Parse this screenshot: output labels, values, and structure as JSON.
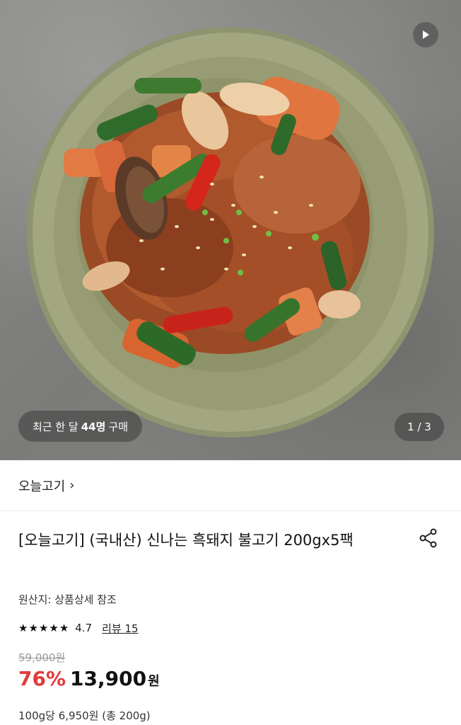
{
  "hero": {
    "recent_prefix": "최근 한 달",
    "recent_count": "44명",
    "recent_suffix": "구매",
    "counter": "1 / 3"
  },
  "brand": {
    "name": "오늘고기",
    "chevron": "›"
  },
  "product": {
    "title": "[오늘고기] (국내산) 신나는 흑돼지 불고기 200gx5팩",
    "origin": "원산지: 상품상세 참조",
    "rating": "4.7",
    "review_link": "리뷰 15",
    "original_price": "59,000원",
    "discount": "76%",
    "price": "13,900",
    "currency": "원",
    "unit_price": "100g당 6,950원 (총 200g)"
  },
  "icons": {
    "play": "play-icon",
    "share": "share-icon",
    "star": "star-icon"
  },
  "colors": {
    "discount": "#e23b3b",
    "strike": "#9a9a9a"
  }
}
